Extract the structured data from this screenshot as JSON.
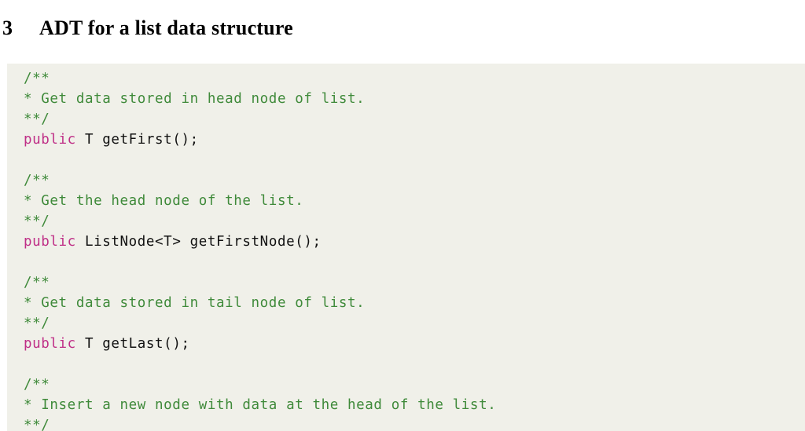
{
  "document": {
    "section_number": "3",
    "section_title": "ADT for a list data structure"
  },
  "colors": {
    "page_background": "#ffffff",
    "listing_background": "#f0f0e9",
    "comment": "#3f8a3a",
    "keyword": "#bf2f87",
    "identifier": "#111111",
    "heading": "#000000"
  },
  "listing": {
    "language": "Java",
    "blocks": [
      {
        "comment_open": "/**",
        "comment_body": "* Get data stored in head node of list.",
        "comment_close": "**/",
        "keyword": "public",
        "signature": " T getFirst();"
      },
      {
        "comment_open": "/**",
        "comment_body": "* Get the head node of the list.",
        "comment_close": "**/",
        "keyword": "public",
        "signature": " ListNode<T> getFirstNode();"
      },
      {
        "comment_open": "/**",
        "comment_body": "* Get data stored in tail node of list.",
        "comment_close": "**/",
        "keyword": "public",
        "signature": " T getLast();"
      },
      {
        "comment_open": "/**",
        "comment_body": "* Insert a new node with data at the head of the list.",
        "comment_close": "**/",
        "keyword": "",
        "signature": ""
      }
    ]
  }
}
